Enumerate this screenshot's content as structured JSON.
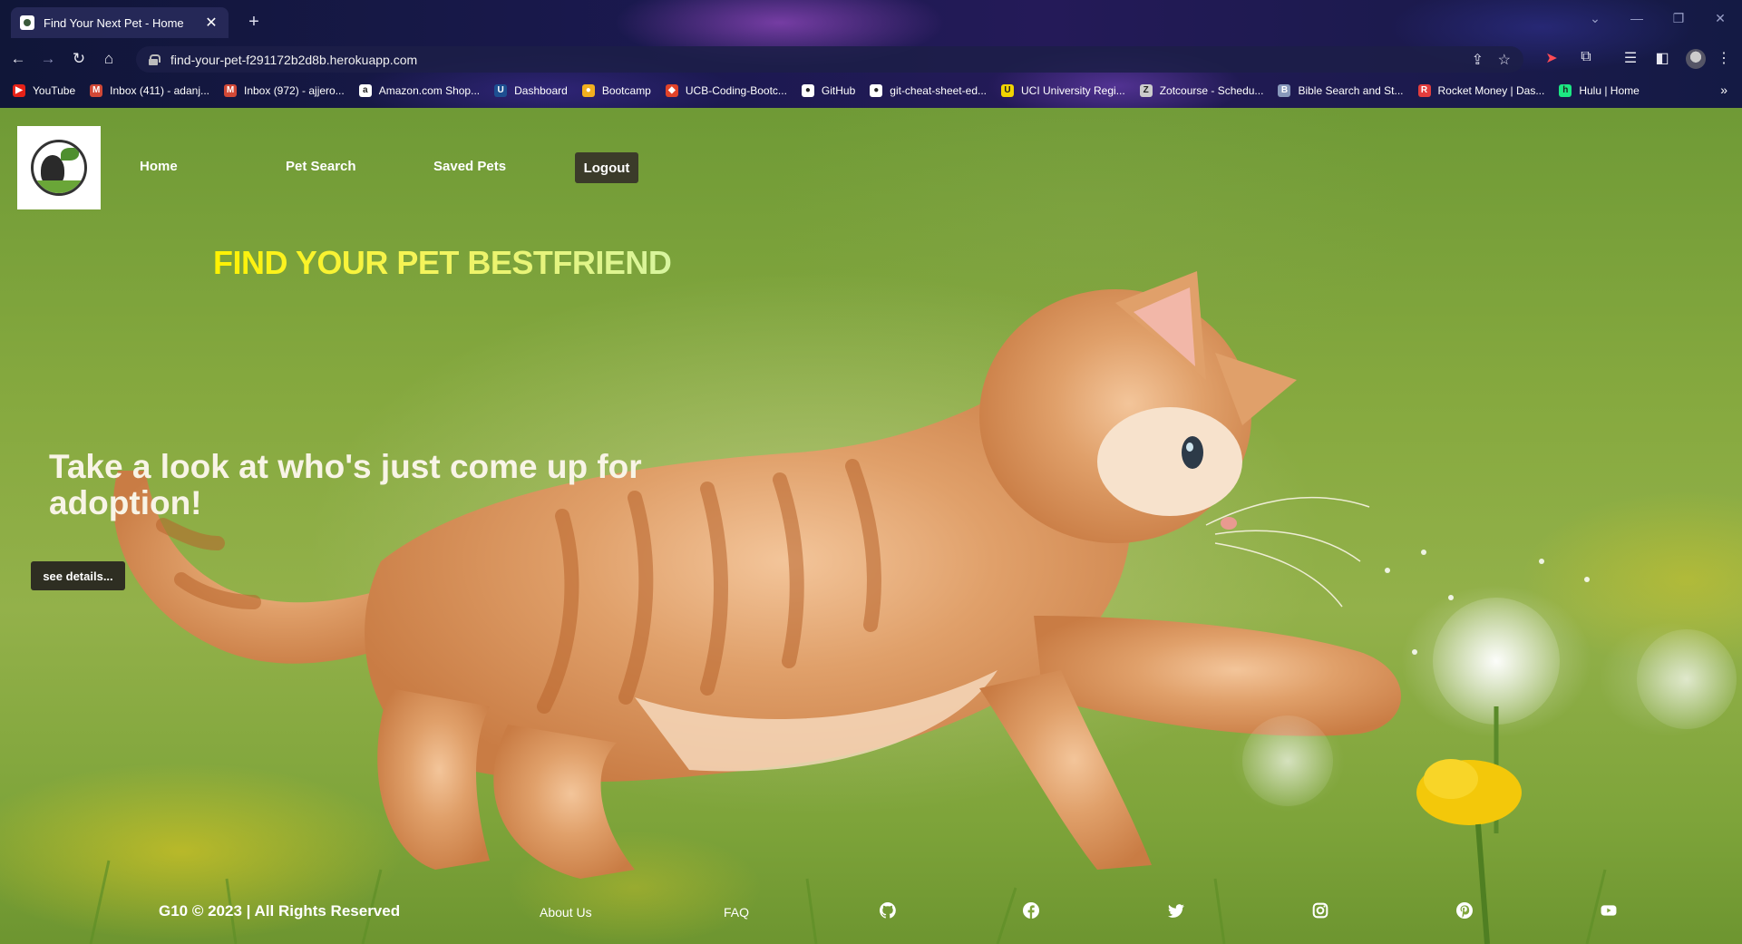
{
  "browser": {
    "tab_title": "Find Your Next Pet - Home",
    "url": "find-your-pet-f291172b2d8b.herokuapp.com",
    "bookmarks": [
      {
        "label": "YouTube",
        "color": "#e62117",
        "glyph": "▶"
      },
      {
        "label": "Inbox (411) - adanj...",
        "color": "#d14836",
        "glyph": "M"
      },
      {
        "label": "Inbox (972) - ajjero...",
        "color": "#d14836",
        "glyph": "M"
      },
      {
        "label": "Amazon.com Shop...",
        "color": "#ffffff",
        "glyph": "a"
      },
      {
        "label": "Dashboard",
        "color": "#1d4f91",
        "glyph": "U"
      },
      {
        "label": "Bootcamp",
        "color": "#f2b01e",
        "glyph": "●"
      },
      {
        "label": "UCB-Coding-Bootc...",
        "color": "#e24329",
        "glyph": "◆"
      },
      {
        "label": "GitHub",
        "color": "#ffffff",
        "glyph": "●"
      },
      {
        "label": "git-cheat-sheet-ed...",
        "color": "#ffffff",
        "glyph": "●"
      },
      {
        "label": "UCI University Regi...",
        "color": "#f2d400",
        "glyph": "U"
      },
      {
        "label": "Zotcourse - Schedu...",
        "color": "#cccccc",
        "glyph": "Z"
      },
      {
        "label": "Bible Search and St...",
        "color": "#8899bb",
        "glyph": "B"
      },
      {
        "label": "Rocket Money | Das...",
        "color": "#e33d3d",
        "glyph": "R"
      },
      {
        "label": "Hulu | Home",
        "color": "#1ce783",
        "glyph": "h"
      }
    ]
  },
  "site": {
    "nav": {
      "home": "Home",
      "pet_search": "Pet Search",
      "saved_pets": "Saved Pets",
      "logout": "Logout"
    },
    "hero_title": "FIND YOUR PET BESTFRIEND",
    "adopt_text": "Take a look at who's just come up for adoption!",
    "details_button": "see details...",
    "footer": {
      "copyright": "G10 © 2023 | All Rights Reserved",
      "about": "About Us",
      "faq": "FAQ",
      "social_icons": [
        "github-icon",
        "facebook-icon",
        "twitter-icon",
        "instagram-icon",
        "pinterest-icon",
        "youtube-icon"
      ]
    }
  },
  "colors": {
    "grass_green": "#86a93f",
    "button_dark": "#3b3b2a",
    "title_yellow": "#fff200"
  }
}
